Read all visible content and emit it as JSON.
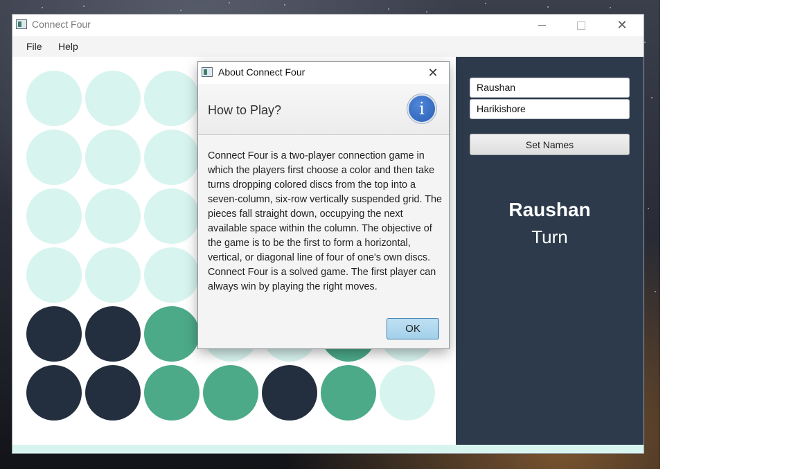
{
  "window": {
    "title": "Connect Four",
    "controls": {
      "minimize": "minimize-icon",
      "maximize": "maximize-icon",
      "close": "close-icon",
      "close_glyph": "✕"
    }
  },
  "menu": {
    "items": [
      {
        "label": "File"
      },
      {
        "label": "Help"
      }
    ]
  },
  "board": {
    "columns": 7,
    "rows": 6,
    "colors": {
      "empty": "#d8f4ef",
      "player_one": "#232f3e",
      "player_two": "#4caa89"
    },
    "cells": [
      [
        "empty",
        "empty",
        "empty",
        "empty",
        "empty",
        "empty",
        "empty"
      ],
      [
        "empty",
        "empty",
        "empty",
        "empty",
        "empty",
        "empty",
        "empty"
      ],
      [
        "empty",
        "empty",
        "empty",
        "empty",
        "empty",
        "empty",
        "empty"
      ],
      [
        "empty",
        "empty",
        "empty",
        "empty",
        "empty",
        "empty",
        "empty"
      ],
      [
        "p1",
        "p1",
        "p2",
        "empty",
        "empty",
        "p2",
        "empty"
      ],
      [
        "p1",
        "p1",
        "p2",
        "p2",
        "p1",
        "p2",
        "empty"
      ]
    ]
  },
  "side_panel": {
    "background": "#2c3a4b",
    "player_one_name": "Raushan",
    "player_two_name": "Harikishore",
    "set_names_label": "Set Names",
    "current_player": "Raushan",
    "turn_label": "Turn"
  },
  "dialog": {
    "title": "About Connect Four",
    "close_glyph": "✕",
    "header": "How to Play?",
    "info_icon": "info-icon",
    "info_glyph": "i",
    "body": "Connect Four is a two-player connection game in which the players first choose a color and then take turns dropping colored discs from the top into a seven-column, six-row vertically suspended grid. The pieces fall straight down, occupying the next available space within the column. The objective of the game is to be the first to form a horizontal, vertical, or diagonal line of four of one's own discs. Connect Four is a solved game. The first player can always win by playing the right moves.",
    "ok_label": "OK"
  }
}
